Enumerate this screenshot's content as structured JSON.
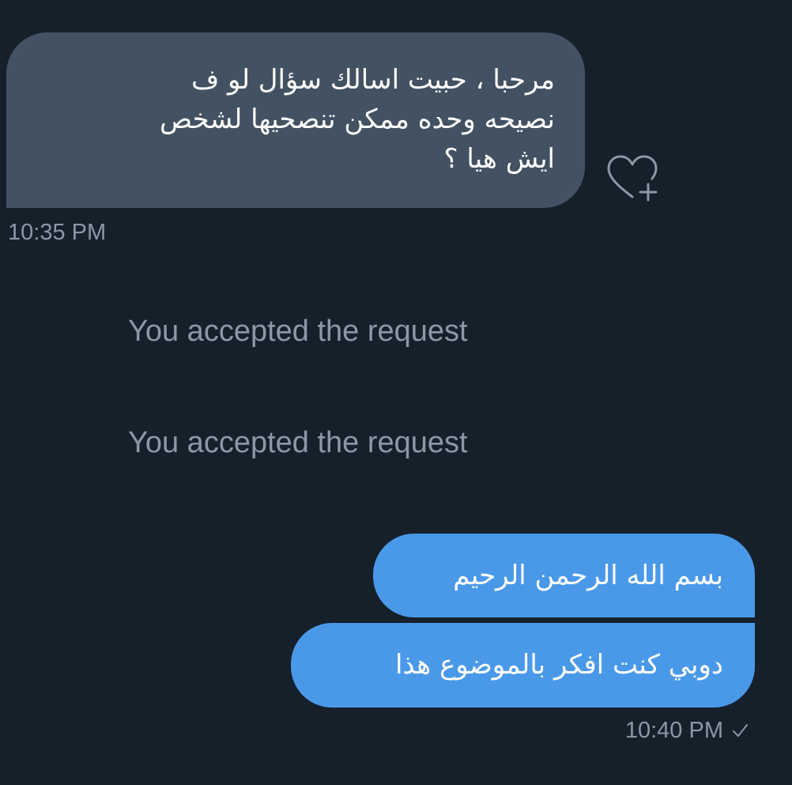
{
  "messages": {
    "incoming": {
      "text": "مرحبا ، حبيت اسالك سؤال لو ف\nنصيحه وحده ممكن تنصحيها لشخص\nايش هيا ؟",
      "time": "10:35 PM"
    },
    "system": [
      "You accepted the request",
      "You accepted the request"
    ],
    "outgoing": [
      {
        "text": "بسم الله الرحمن الرحيم"
      },
      {
        "text": "دوبي كنت افكر بالموضوع هذا"
      }
    ],
    "outgoing_time": "10:40 PM"
  },
  "icons": {
    "react": "heart-plus-icon",
    "sent_status": "check-icon"
  },
  "colors": {
    "background": "#15202b",
    "incoming_bubble": "#425262",
    "outgoing_bubble": "#4a99e9",
    "muted_text": "#8b98a5"
  }
}
